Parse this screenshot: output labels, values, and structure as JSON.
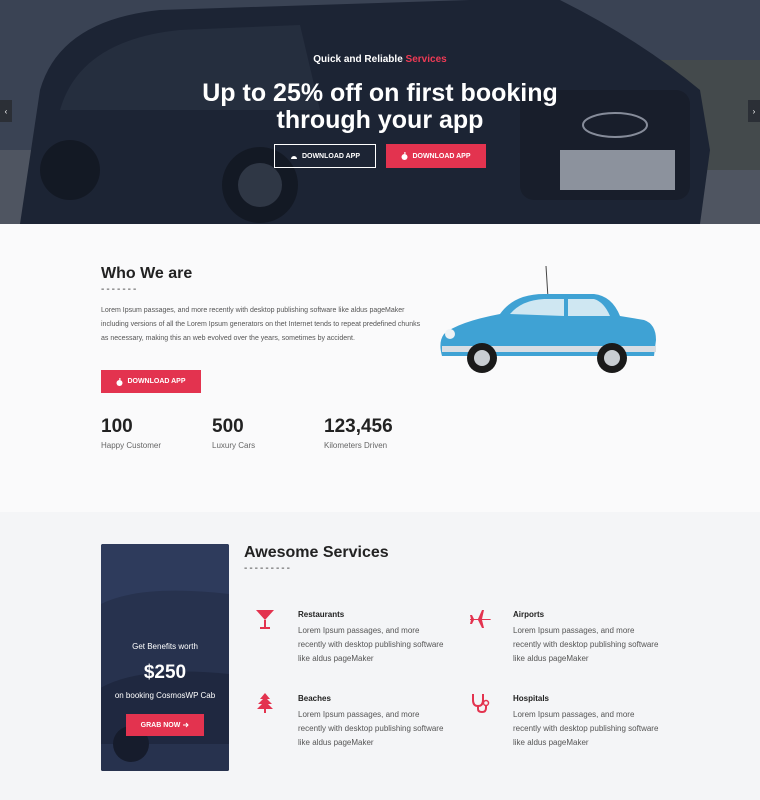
{
  "hero": {
    "subtitle_prefix": "Quick and Reliable",
    "subtitle_accent": "Services",
    "title_line1": "Up to 25% off on first booking",
    "title_line2": "through your app",
    "btn_outline_label": "DOWNLOAD APP",
    "btn_red_label": "DOWNLOAD APP",
    "prev_arrow": "‹",
    "next_arrow": "›"
  },
  "who": {
    "title": "Who We are",
    "dash": "-------",
    "text": "Lorem Ipsum passages, and more recently with desktop publishing software like aldus pageMaker including versions of all the Lorem Ipsum generators on thet Internet tends to repeat predefined chunks as necessary, making this an web evolved over the years, sometimes by accident.",
    "button_label": "DOWNLOAD APP",
    "stats": [
      {
        "value": "100",
        "label": "Happy Customer"
      },
      {
        "value": "500",
        "label": "Luxury Cars"
      },
      {
        "value": "123,456",
        "label": "Kilometers Driven"
      }
    ]
  },
  "promo": {
    "line1": "Get Benefits worth",
    "price": "$250",
    "line2": "on booking CosmosWP Cab",
    "button_label": "GRAB NOW"
  },
  "services": {
    "title": "Awesome Services",
    "dash": "---------",
    "items": [
      {
        "name": "Restaurants",
        "icon": "cocktail-icon",
        "desc": "Lorem Ipsum passages, and more recently with desktop publishing software like aldus pageMaker"
      },
      {
        "name": "Airports",
        "icon": "plane-icon",
        "desc": "Lorem Ipsum passages, and more recently with desktop publishing software like aldus pageMaker"
      },
      {
        "name": "Beaches",
        "icon": "tree-icon",
        "desc": "Lorem Ipsum passages, and more recently with desktop publishing software like aldus pageMaker"
      },
      {
        "name": "Hospitals",
        "icon": "stethoscope-icon",
        "desc": "Lorem Ipsum passages, and more recently with desktop publishing software like aldus pageMaker"
      }
    ]
  },
  "colors": {
    "accent": "#e3334f",
    "dark_navy": "#2d3a5a",
    "text_dark": "#222222",
    "text_muted": "#555555"
  }
}
